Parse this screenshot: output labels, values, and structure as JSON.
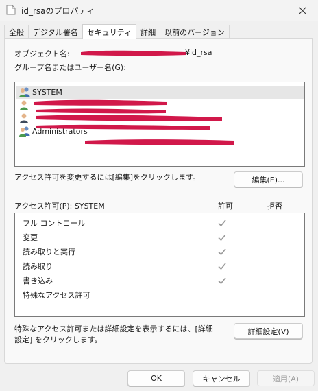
{
  "window": {
    "title": "id_rsaのプロパティ"
  },
  "tabs": [
    {
      "label": "全般"
    },
    {
      "label": "デジタル署名"
    },
    {
      "label": "セキュリティ"
    },
    {
      "label": "詳細"
    },
    {
      "label": "以前のバージョン"
    }
  ],
  "security": {
    "object_name_label": "オブジェクト名:",
    "object_name_value": "¥id_rsa",
    "groups_label": "グループ名またはユーザー名(G):",
    "users": [
      {
        "name": "SYSTEM",
        "icon": "group-users-icon"
      },
      {
        "name": "",
        "icon": "user-icon"
      },
      {
        "name": "",
        "icon": "user-icon"
      },
      {
        "name": "Administrators",
        "icon": "group-users-icon"
      }
    ],
    "edit_hint": "アクセス許可を変更するには[編集]をクリックします。",
    "edit_button": "編集(E)...",
    "permissions_label": "アクセス許可(P): SYSTEM",
    "allow_header": "許可",
    "deny_header": "拒否",
    "permissions": [
      {
        "name": "フル コントロール",
        "allow": true,
        "deny": false
      },
      {
        "name": "変更",
        "allow": true,
        "deny": false
      },
      {
        "name": "読み取りと実行",
        "allow": true,
        "deny": false
      },
      {
        "name": "読み取り",
        "allow": true,
        "deny": false
      },
      {
        "name": "書き込み",
        "allow": true,
        "deny": false
      },
      {
        "name": "特殊なアクセス許可",
        "allow": false,
        "deny": false
      }
    ],
    "advanced_hint_line1": "特殊なアクセス許可または詳細設定を表示するには、[詳細",
    "advanced_hint_line2": "設定] をクリックします。",
    "advanced_button": "詳細設定(V)"
  },
  "footer": {
    "ok": "OK",
    "cancel": "キャンセル",
    "apply": "適用(A)"
  },
  "colors": {
    "redaction": "#d1184a",
    "check": "#9a9a9a",
    "selected_row": "#e6e6e6"
  }
}
